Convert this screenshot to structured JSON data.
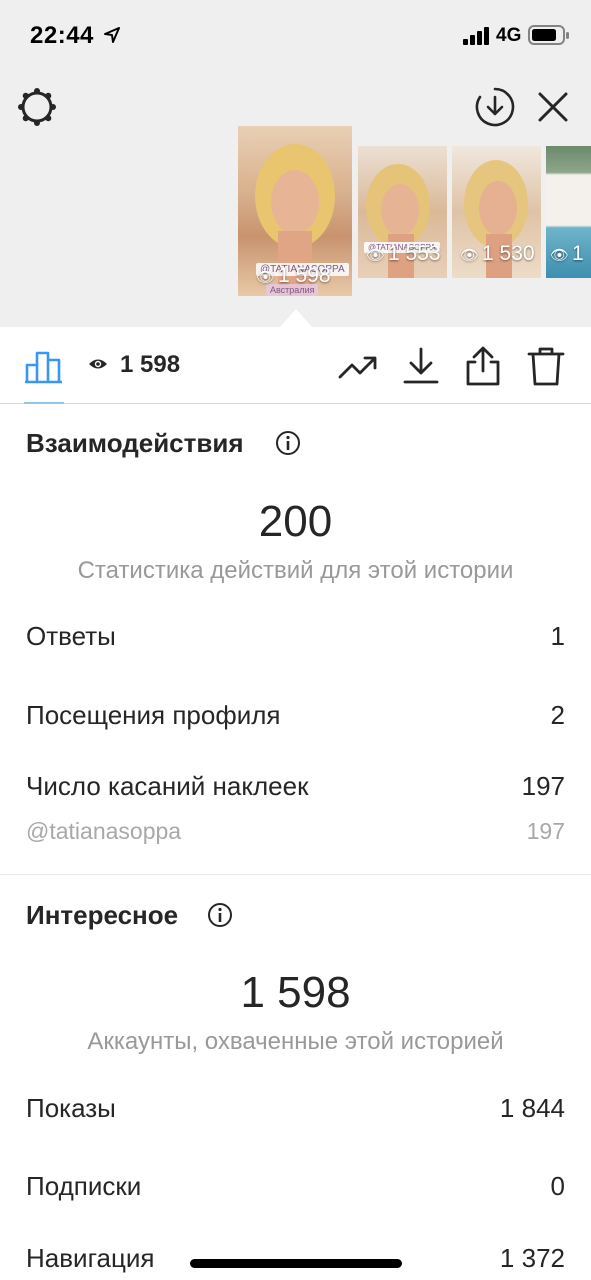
{
  "status_bar": {
    "time": "22:44",
    "network": "4G"
  },
  "thumbnails": [
    {
      "views": "1 598",
      "tag": "@TATIANASOPPA",
      "caption": "Австралия"
    },
    {
      "views": "1 553",
      "tag": "@TATIANASOPPA"
    },
    {
      "views": "1 530"
    },
    {
      "views": "1"
    }
  ],
  "toolbar": {
    "views": "1 598",
    "active_tab_color": "#8ec6f0",
    "icons": [
      "bar-chart-icon",
      "eye-icon",
      "trend-icon",
      "download-icon",
      "share-icon",
      "trash-icon"
    ]
  },
  "interactions": {
    "title": "Взаимодействия",
    "total": "200",
    "subtitle": "Статистика действий для этой истории",
    "rows": [
      {
        "label": "Ответы",
        "value": "1"
      },
      {
        "label": "Посещения профиля",
        "value": "2"
      },
      {
        "label": "Число касаний наклеек",
        "value": "197"
      }
    ],
    "sub_row": {
      "label": "@tatianasoppa",
      "value": "197"
    }
  },
  "discovery": {
    "title": "Интересное",
    "total": "1 598",
    "subtitle": "Аккаунты, охваченные этой историей",
    "rows": [
      {
        "label": "Показы",
        "value": "1 844"
      },
      {
        "label": "Подписки",
        "value": "0"
      },
      {
        "label": "Навигация",
        "value": "1 372"
      }
    ]
  }
}
